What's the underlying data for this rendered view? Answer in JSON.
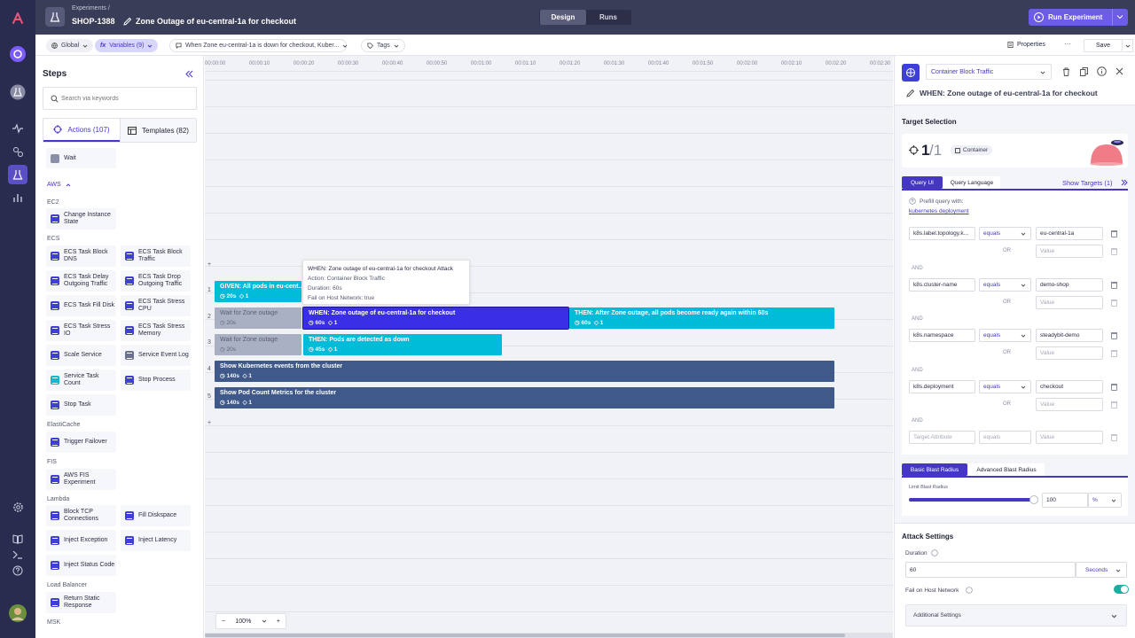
{
  "app": {
    "breadcrumb": "Experiments /",
    "experiment_key": "SHOP-1388",
    "experiment_title": "Zone Outage of eu-central-1a for checkout"
  },
  "mode_tabs": [
    {
      "label": "Design",
      "active": true
    },
    {
      "label": "Runs",
      "active": false
    }
  ],
  "run_button": "Run Experiment",
  "toolbar": {
    "env": "Global",
    "variables": "Variables (9)",
    "hypothesis": "When Zone eu-central-1a is down for checkout, Kuber...",
    "tags": "Tags",
    "properties": "Properties",
    "more": "···",
    "save": "Save"
  },
  "steps_panel": {
    "title": "Steps",
    "search_placeholder": "Search via keywords",
    "tabs": [
      {
        "label": "Actions (107)"
      },
      {
        "label": "Templates (82)"
      }
    ],
    "wait": "Wait",
    "aws_label": "AWS",
    "groups": {
      "ec2": "EC2",
      "ecs": "ECS",
      "elasticache": "ElastiCache",
      "fis": "FIS",
      "lambda": "Lambda",
      "lb": "Load Balancer",
      "msk": "MSK"
    },
    "items": {
      "change_instance_state": "Change Instance State",
      "ecs_task_block_dns": "ECS Task Block DNS",
      "ecs_task_block_traffic": "ECS Task Block Traffic",
      "ecs_task_delay_outgoing": "ECS Task Delay Outgoing Traffic",
      "ecs_task_drop_outgoing": "ECS Task Drop Outgoing Traffic",
      "ecs_task_fill_disk": "ECS Task Fill Disk",
      "ecs_task_stress_cpu": "ECS Task Stress CPU",
      "ecs_task_stress_io": "ECS Task Stress IO",
      "ecs_task_stress_memory": "ECS Task Stress Memory",
      "scale_service": "Scale Service",
      "service_event_log": "Service Event Log",
      "service_task_count": "Service Task Count",
      "stop_process": "Stop Process",
      "stop_task": "Stop Task",
      "trigger_failover": "Trigger Failover",
      "aws_fis_experiment": "AWS FIS Experiment",
      "block_tcp": "Block TCP Connections",
      "fill_diskspace": "Fill Diskspace",
      "inject_exception": "Inject Exception",
      "inject_latency": "Inject Latency",
      "inject_status_code": "Inject Status Code",
      "return_static_response": "Return Static Response"
    }
  },
  "timeline": {
    "ticks": [
      "00:00:00",
      "00:00:10",
      "00:00:20",
      "00:00:30",
      "00:00:40",
      "00:00:50",
      "00:01:00",
      "00:01:10",
      "00:01:20",
      "00:01:30",
      "00:01:40",
      "00:01:50",
      "00:02:00",
      "00:02:10",
      "00:02:20",
      "00:02:30"
    ],
    "lanes": [
      "1",
      "2",
      "3",
      "4",
      "5"
    ],
    "plus": "+",
    "zoom": "100%",
    "blocks": {
      "given": {
        "title": "GIVEN: All pods in eu-cent...",
        "duration": "20s",
        "count": "1"
      },
      "wait1": {
        "title": "Wait for Zone outage",
        "duration": "20s"
      },
      "when": {
        "title": "WHEN: Zone outage of eu-central-1a for checkout",
        "duration": "60s",
        "count": "1"
      },
      "then1": {
        "title": "THEN: After Zone outage, all pods become ready again within 60s",
        "duration": "60s",
        "count": "1"
      },
      "wait2": {
        "title": "Wait for Zone outage",
        "duration": "20s"
      },
      "then2": {
        "title": "THEN: Pods are detected as down",
        "duration": "45s",
        "count": "1"
      },
      "events": {
        "title": "Show Kubernetes events from the cluster",
        "duration": "140s",
        "count": "1"
      },
      "metrics": {
        "title": "Show Pod Count Metrics for the cluster",
        "duration": "140s",
        "count": "1"
      }
    },
    "tooltip": {
      "title": "WHEN: Zone outage of eu-central-1a for checkout Attack",
      "action": "Action: Container Block Traffic",
      "duration": "Duration: 60s",
      "fail": "Fail on Host Network: true"
    }
  },
  "detail": {
    "action_select": "Container Block Traffic",
    "step_title": "WHEN: Zone outage of eu-central-1a for checkout",
    "target_selection": "Target Selection",
    "count": "1/1",
    "count_big": "1",
    "count_rest": "/1",
    "target_type": "Container",
    "query_tabs": [
      "Query UI",
      "Query Language"
    ],
    "show_targets": "Show Targets (1)",
    "prefill": "Prefill query with:",
    "prefill_link": "kubernetes deployment",
    "rows": [
      {
        "key": "k8s.label.topology.k...",
        "op": "equals",
        "value": "eu-central-1a"
      },
      {
        "key": "k8s.cluster-name",
        "op": "equals",
        "value": "demo-shop"
      },
      {
        "key": "k8s.namespace",
        "op": "equals",
        "value": "steadybit-demo"
      },
      {
        "key": "k8s.deployment",
        "op": "equals",
        "value": "checkout"
      }
    ],
    "or": "OR",
    "and": "AND",
    "value_placeholder": "Value",
    "target_attr_placeholder": "Target Attribute",
    "blast_tabs": [
      "Basic Blast Radius",
      "Advanced Blast Radius"
    ],
    "limit_label": "Limit Blast Radius",
    "limit_value": "100",
    "limit_unit": "%",
    "limit_fraction": 1.0,
    "attack_settings": "Attack Settings",
    "duration_label": "Duration",
    "duration_value": "60",
    "duration_unit": "Seconds",
    "fail_host": "Fail on Host Network",
    "fail_host_on": true,
    "additional": "Additional Settings"
  },
  "colors": {
    "accent": "#5a4fc4",
    "when_block": "#3a2ee6",
    "then_block": "#00bcd9",
    "info_block": "#3f5a8a",
    "given_block": "#00bcd9",
    "wait_block": "#aab0c4",
    "toggle": "#15b0a2"
  }
}
